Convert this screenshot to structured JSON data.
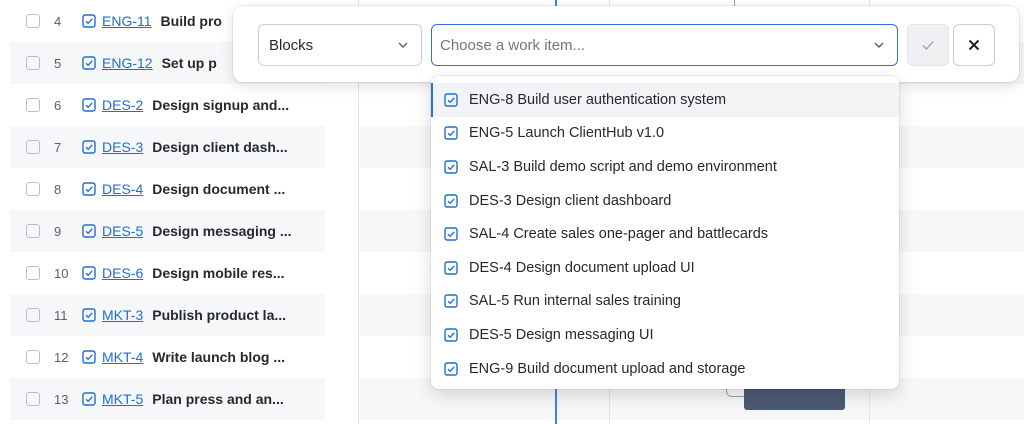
{
  "list": {
    "rows": [
      {
        "num": "4",
        "key": "ENG-11",
        "title": "Build pro"
      },
      {
        "num": "5",
        "key": "ENG-12",
        "title": "Set up p"
      },
      {
        "num": "6",
        "key": "DES-2",
        "title": "Design signup and..."
      },
      {
        "num": "7",
        "key": "DES-3",
        "title": "Design client dash..."
      },
      {
        "num": "8",
        "key": "DES-4",
        "title": "Design document ..."
      },
      {
        "num": "9",
        "key": "DES-5",
        "title": "Design messaging ..."
      },
      {
        "num": "10",
        "key": "DES-6",
        "title": "Design mobile res..."
      },
      {
        "num": "11",
        "key": "MKT-3",
        "title": "Publish product la..."
      },
      {
        "num": "12",
        "key": "MKT-4",
        "title": "Write launch blog ..."
      },
      {
        "num": "13",
        "key": "MKT-5",
        "title": "Plan press and an..."
      }
    ]
  },
  "panel": {
    "type_value": "Blocks",
    "item_placeholder": "Choose a work item...",
    "confirm_icon": "check-icon",
    "cancel_icon": "close-icon"
  },
  "dropdown": {
    "options": [
      {
        "label": "ENG-8 Build user authentication system"
      },
      {
        "label": "ENG-5 Launch ClientHub v1.0"
      },
      {
        "label": "SAL-3 Build demo script and demo environment"
      },
      {
        "label": "DES-3 Design client dashboard"
      },
      {
        "label": "SAL-4 Create sales one-pager and battlecards"
      },
      {
        "label": "DES-4 Design document upload UI"
      },
      {
        "label": "SAL-5 Run internal sales training"
      },
      {
        "label": "DES-5 Design messaging UI"
      },
      {
        "label": "ENG-9 Build document upload and storage"
      }
    ]
  },
  "colors": {
    "accent": "#2f6fdf",
    "link": "#1f6fd1",
    "bar": "#4c5a72"
  }
}
